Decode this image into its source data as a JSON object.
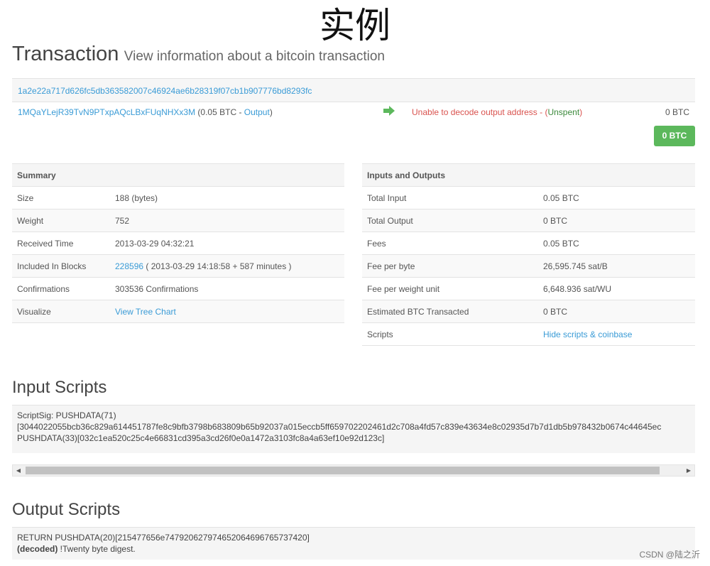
{
  "caption": "实例",
  "header": {
    "title": "Transaction",
    "subtitle": "View information about a bitcoin transaction"
  },
  "transaction": {
    "hash": "1a2e22a717d626fc5db363582007c46924ae6b28319f07cb1b907776bd8293fc",
    "input_address": "1MQaYLejR39TvN9PTxpAQcLBxFUqNHXx3M",
    "input_open": "(0.05 BTC - ",
    "input_output_link": "Output",
    "input_close": ")",
    "output_error": "Unable to decode output address - (",
    "output_unspent": "Unspent",
    "output_close": ")",
    "output_amount": "0 BTC",
    "total_badge": "0 BTC"
  },
  "summary": {
    "header": "Summary",
    "rows": [
      {
        "label": "Size",
        "value": "188 (bytes)"
      },
      {
        "label": "Weight",
        "value": "752"
      },
      {
        "label": "Received Time",
        "value": "2013-03-29 04:32:21"
      },
      {
        "label": "Included In Blocks",
        "block_link": "228596",
        "value": " ( 2013-03-29 14:18:58 + 587 minutes )"
      },
      {
        "label": "Confirmations",
        "value": "303536 Confirmations"
      },
      {
        "label": "Visualize",
        "link": "View Tree Chart"
      }
    ]
  },
  "inputs_outputs": {
    "header": "Inputs and Outputs",
    "rows": [
      {
        "label": "Total Input",
        "value": "0.05 BTC"
      },
      {
        "label": "Total Output",
        "value": "0 BTC"
      },
      {
        "label": "Fees",
        "value": "0.05 BTC"
      },
      {
        "label": "Fee per byte",
        "value": "26,595.745 sat/B"
      },
      {
        "label": "Fee per weight unit",
        "value": "6,648.936 sat/WU"
      },
      {
        "label": "Estimated BTC Transacted",
        "value": "0 BTC"
      },
      {
        "label": "Scripts",
        "link": "Hide scripts & coinbase"
      }
    ]
  },
  "input_scripts": {
    "heading": "Input Scripts",
    "line1": "ScriptSig: PUSHDATA(71)",
    "line2": "[3044022055bcb36c829a614451787fe8c9bfb3798b683809b65b92037a015eccb5ff659702202461d2c708a4fd57c839e43634e8c02935d7b7d1db5b978432b0674c44645ec",
    "line3": "PUSHDATA(33)[032c1ea520c25c4e66831cd395a3cd26f0e0a1472a3103fc8a4a63ef10e92d123c]"
  },
  "output_scripts": {
    "heading": "Output Scripts",
    "line1": "RETURN PUSHDATA(20)[215477656e747920627974652064696765737420]",
    "decoded_label": "(decoded)",
    "decoded_text": " !Twenty byte digest."
  },
  "watermark": "CSDN @陆之沂",
  "colors": {
    "link": "#3a9bd6",
    "error": "#d9534f",
    "unspent": "#3c8a3c",
    "badge": "#5cb85c",
    "arrow": "#5cb85c"
  }
}
